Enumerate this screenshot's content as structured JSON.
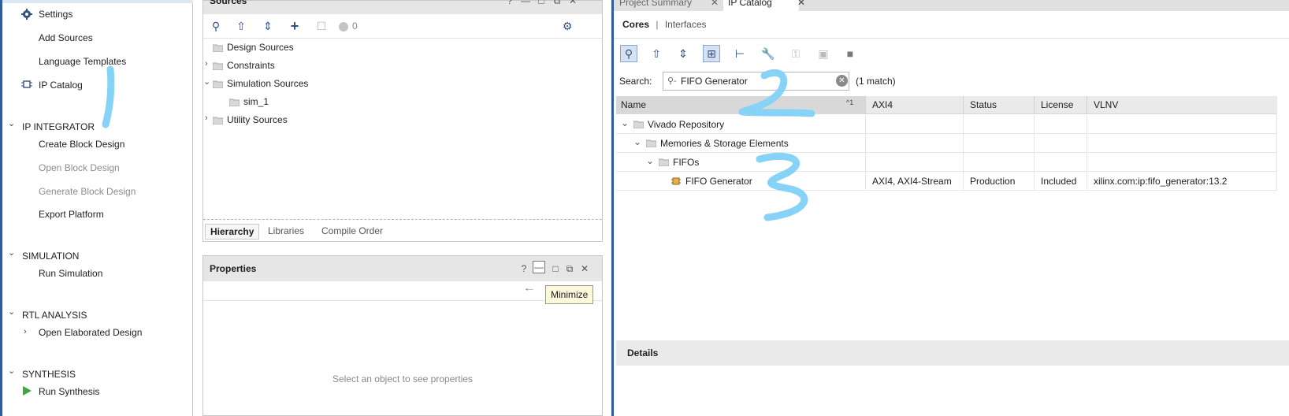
{
  "flow_navigator": {
    "items": [
      {
        "label": "Settings",
        "icon": "gear-icon"
      },
      {
        "label": "Add Sources"
      },
      {
        "label": "Language Templates"
      },
      {
        "label": "IP Catalog",
        "icon": "ip-chip-icon"
      }
    ],
    "sections": [
      {
        "title": "IP INTEGRATOR",
        "items": [
          "Create Block Design",
          "Open Block Design",
          "Generate Block Design",
          "Export Platform"
        ],
        "disabled": [
          "Open Block Design",
          "Generate Block Design"
        ]
      },
      {
        "title": "SIMULATION",
        "items": [
          "Run Simulation"
        ]
      },
      {
        "title": "RTL ANALYSIS",
        "items": [
          "Open Elaborated Design"
        ]
      },
      {
        "title": "SYNTHESIS",
        "items": [
          "Run Synthesis"
        ]
      }
    ]
  },
  "sources_panel": {
    "title": "Sources",
    "badge_count": "0",
    "tree": [
      {
        "label": "Design Sources"
      },
      {
        "label": "Constraints"
      },
      {
        "label": "Simulation Sources"
      },
      {
        "label": "sim_1"
      },
      {
        "label": "Utility Sources"
      }
    ],
    "bottom_tabs": [
      "Hierarchy",
      "Libraries",
      "Compile Order"
    ]
  },
  "properties_panel": {
    "title": "Properties",
    "empty_text": "Select an object to see properties",
    "tooltip": "Minimize"
  },
  "ip_catalog": {
    "doc_tabs": [
      "Project Summary",
      "IP Catalog"
    ],
    "subtabs": [
      "Cores",
      "Interfaces"
    ],
    "subtab_separator": "|",
    "search_label": "Search:",
    "search_value": "FIFO Generator",
    "match_count": "(1 match)",
    "columns": [
      "Name",
      "AXI4",
      "Status",
      "License",
      "VLNV"
    ],
    "sort_indicator": "^1",
    "rows": [
      {
        "name": "Vivado Repository",
        "axi4": "",
        "status": "",
        "license": "",
        "vlnv": ""
      },
      {
        "name": "Memories & Storage Elements",
        "axi4": "",
        "status": "",
        "license": "",
        "vlnv": ""
      },
      {
        "name": "FIFOs",
        "axi4": "",
        "status": "",
        "license": "",
        "vlnv": ""
      },
      {
        "name": "FIFO Generator",
        "axi4": "AXI4, AXI4-Stream",
        "status": "Production",
        "license": "Included",
        "vlnv": "xilinx.com:ip:fifo_generator:13.2"
      }
    ],
    "details_title": "Details"
  },
  "annotations": [
    "1",
    "2",
    "3"
  ],
  "colors": {
    "accent_blue": "#2f5c9c",
    "annotation": "#86d3f7",
    "run_green": "#3aa845",
    "tooltip_bg": "#fbf8dc"
  }
}
